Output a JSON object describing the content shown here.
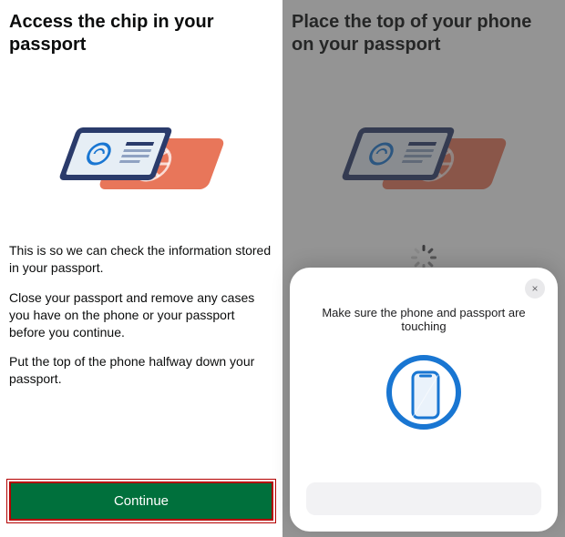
{
  "left": {
    "title": "Access the chip in your passport",
    "body1": "This is so we can check the information stored in your passport.",
    "body2": "Close your passport and remove any cases you have on the phone or your passport before you continue.",
    "body3": "Put the top of the phone halfway down your passport.",
    "continue_label": "Continue"
  },
  "right": {
    "title": "Place the top of your phone on your passport",
    "sheet_message": "Make sure the phone and passport are touching",
    "close_label": "×"
  },
  "colors": {
    "primary_button": "#00703c",
    "highlight_border": "#b40000",
    "accent_blue": "#1976d2",
    "passport_orange": "#e8765a",
    "phone_navy": "#2a3b6b"
  }
}
